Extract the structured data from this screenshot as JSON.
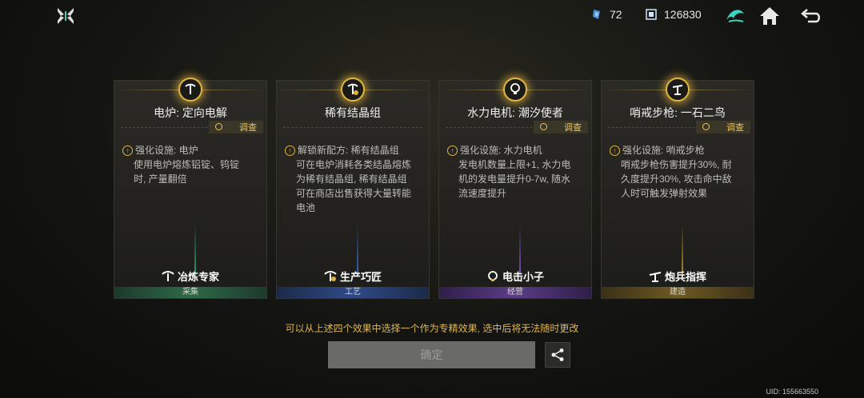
{
  "header": {
    "gems": "72",
    "coins": "126830"
  },
  "cards": [
    {
      "title": "电炉: 定向电解",
      "survey_label": "调查",
      "desc_lines": [
        "强化设施: 电炉",
        "使用电炉熔炼铝锭、钨锭",
        "时, 产量翻倍"
      ],
      "skill": "冶炼专家",
      "category": "采集",
      "accent": "#2f9a66"
    },
    {
      "title": "稀有结晶组",
      "survey_label": "",
      "desc_lines": [
        "解锁新配方: 稀有结晶组",
        "可在电炉消耗各类结晶熔炼",
        "为稀有结晶组, 稀有结晶组",
        "可在商店出售获得大量转能",
        "电池"
      ],
      "skill": "生产巧匠",
      "category": "工艺",
      "accent": "#3a64b8"
    },
    {
      "title": "水力电机: 潮汐使者",
      "survey_label": "调查",
      "desc_lines": [
        "强化设施: 水力电机",
        "发电机数量上限+1, 水力电",
        "机的发电量提升0-7w, 随水",
        "流速度提升"
      ],
      "skill": "电击小子",
      "category": "经营",
      "accent": "#7b4fb8"
    },
    {
      "title": "哨戒步枪: 一石二鸟",
      "survey_label": "调查",
      "desc_lines": [
        "强化设施: 哨戒步枪",
        "哨戒步枪伤害提升30%, 耐",
        "久度提升30%, 攻击命中敌",
        "人时可触发弹射效果"
      ],
      "skill": "炮兵指挥",
      "category": "建造",
      "accent": "#a8892e"
    }
  ],
  "footer": {
    "hint": "可以从上述四个效果中选择一个作为专精效果, 选中后将无法随时更改",
    "confirm_label": "确定",
    "uid": "UID: 155663550"
  }
}
